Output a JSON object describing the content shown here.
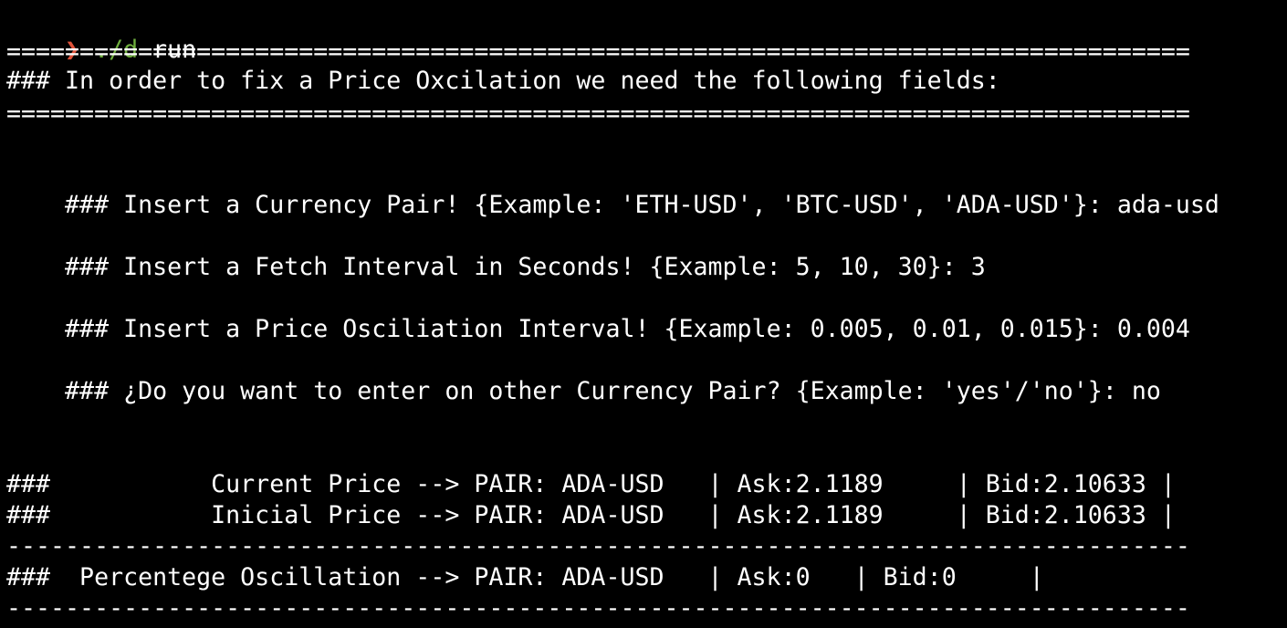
{
  "prompt": {
    "arrow": "❯",
    "path": "./d",
    "command": " run"
  },
  "rules": {
    "double": "=================================================================================",
    "single": "---------------------------------------------------------------------------------"
  },
  "header_line": "### In order to fix a Price Oxcilation we need the following fields:",
  "inputs": [
    {
      "question": "### Insert a Currency Pair! {Example: 'ETH-USD', 'BTC-USD', 'ADA-USD'}: ",
      "answer": "ada-usd"
    },
    {
      "question": "### Insert a Fetch Interval in Seconds! {Example: 5, 10, 30}: ",
      "answer": "3"
    },
    {
      "question": "### Insert a Price Osciliation Interval! {Example: 0.005, 0.01, 0.015}: ",
      "answer": "0.004"
    },
    {
      "question": "### ¿Do you want to enter on other Currency Pair? {Example: 'yes'/'no'}: ",
      "answer": "no"
    }
  ],
  "price_rows": [
    "###           Current Price --> PAIR: ADA-USD   | Ask:2.1189     | Bid:2.10633 |",
    "###           Inicial Price --> PAIR: ADA-USD   | Ask:2.1189     | Bid:2.10633 |"
  ],
  "oscillation_row": "###  Percentege Oscillation --> PAIR: ADA-USD   | Ask:0   | Bid:0     |"
}
